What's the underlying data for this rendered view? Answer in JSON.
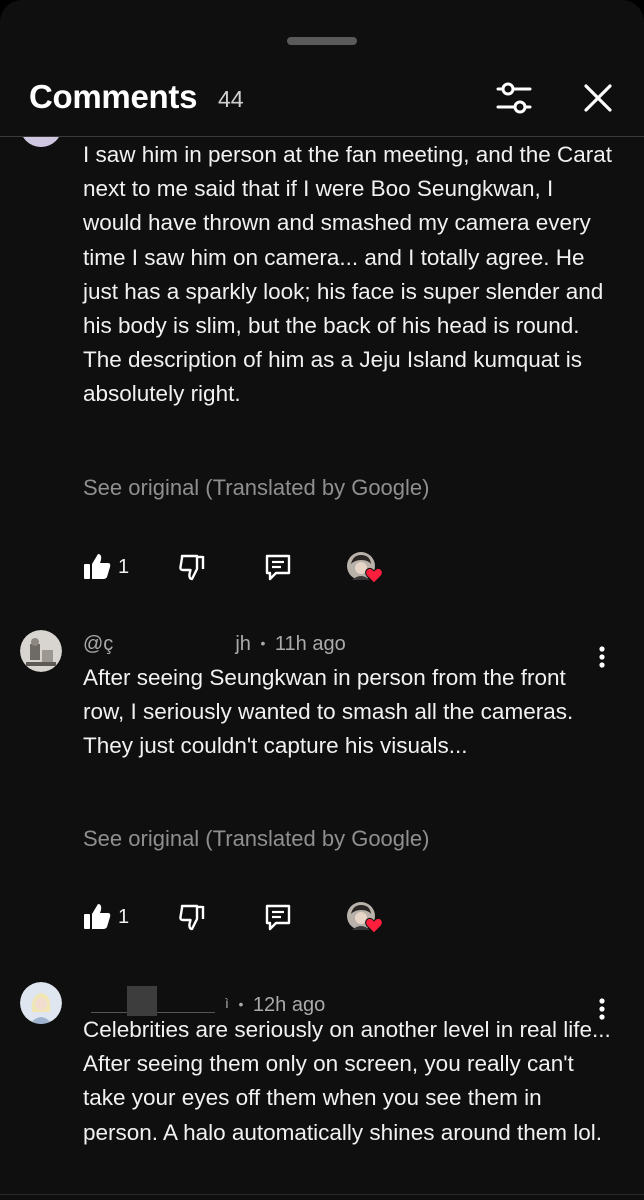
{
  "header": {
    "title": "Comments",
    "count": "44",
    "filter_icon": "sliders-icon",
    "close_icon": "close-icon"
  },
  "comments": [
    {
      "author": "",
      "time": "",
      "text": "I saw him in person at the fan meeting, and the Carat next to me said that if I were Boo Seungkwan, I would have thrown and smashed my camera every time I saw him on camera... and I totally agree. He just has a sparkly look; his face is super slender and his body is slim, but the back of his head is round. The description of him as a Jeju Island kumquat is absolutely right.",
      "see_original": "See original (Translated by Google)",
      "likes": "1",
      "creator_hearted": true
    },
    {
      "author_prefix": "@ç",
      "author_suffix": "jh",
      "time": "11h ago",
      "text": "After seeing Seungkwan in person from the front row, I seriously wanted to smash all the cameras. They just couldn't capture his visuals...",
      "see_original": "See original (Translated by Google)",
      "likes": "1",
      "creator_hearted": true
    },
    {
      "author_suffix": "ì",
      "time": "12h ago",
      "text": "Celebrities are seriously on another level in real life... After seeing them only on screen, you really can't take your eyes off them when you see them in person. A halo automatically shines around them lol."
    }
  ],
  "separator": "•",
  "colors": {
    "background": "#0f0f0f",
    "text_primary": "#f1f1f1",
    "text_secondary": "#aaaaaa",
    "heart": "#ff1f3d"
  },
  "icons": {
    "like": "thumbs-up-icon",
    "dislike": "thumbs-down-icon",
    "reply": "reply-comment-icon",
    "more": "more-vertical-icon",
    "heart": "heart-icon"
  }
}
